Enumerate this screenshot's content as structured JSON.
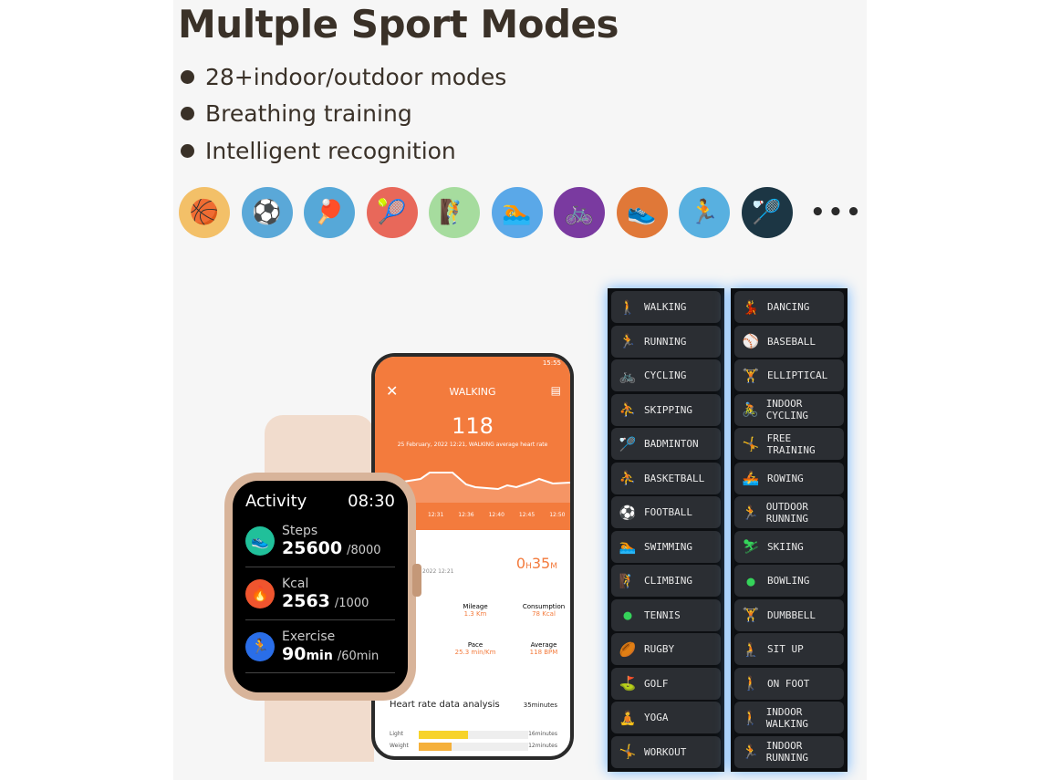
{
  "title": "Multple Sport Modes",
  "bullets": [
    "28+indoor/outdoor modes",
    "Breathing training",
    "Intelligent recognition"
  ],
  "sport_icons": [
    {
      "name": "basketball",
      "color": "#f3c068",
      "glyph": "🏀"
    },
    {
      "name": "soccer",
      "color": "#5aa8d8",
      "glyph": "⚽"
    },
    {
      "name": "ping-pong",
      "color": "#56a8d8",
      "glyph": "🏓"
    },
    {
      "name": "tennis",
      "color": "#e8685a",
      "glyph": "🎾"
    },
    {
      "name": "climbing",
      "color": "#a6dc9e",
      "glyph": "🧗"
    },
    {
      "name": "swimming",
      "color": "#5aa8e8",
      "glyph": "🏊"
    },
    {
      "name": "cycling",
      "color": "#7a3aa0",
      "glyph": "🚲"
    },
    {
      "name": "running-shoe",
      "color": "#e07838",
      "glyph": "👟"
    },
    {
      "name": "treadmill",
      "color": "#58b0e0",
      "glyph": "🏃"
    },
    {
      "name": "badminton",
      "color": "#1c3644",
      "glyph": "🏸"
    }
  ],
  "more": "•••",
  "list_left": [
    "WALKING",
    "RUNNING",
    "CYCLING",
    "SKIPPING",
    "BADMINTON",
    "BASKETBALL",
    "FOOTBALL",
    "SWIMMING",
    "CLIMBING",
    "TENNIS",
    "RUGBY",
    "GOLF",
    "YOGA",
    "WORKOUT"
  ],
  "list_right": [
    "DANCING",
    "BASEBALL",
    "ELLIPTICAL",
    "INDOOR CYCLING",
    "FREE TRAINING",
    "ROWING",
    "OUTDOOR RUNNING",
    "SKIING",
    "BOWLING",
    "DUMBBELL",
    "SIT UP",
    "ON FOOT",
    "INDOOR WALKING",
    "INDOOR RUNNING"
  ],
  "accent": "#35d35a",
  "phone": {
    "status_time": "15:55",
    "header": "WALKING",
    "heart_rate": "118",
    "subtitle": "25 February, 2022 12:21, WALKING average heart rate",
    "ticks": [
      "12:31",
      "12:36",
      "12:40",
      "12:45",
      "12:50",
      "12:5"
    ],
    "date": "2022 12:21",
    "duration_h": "0",
    "h": "H",
    "duration_m": "35",
    "m": "M",
    "stats": [
      {
        "label": "Mileage",
        "value": "1.3 Km"
      },
      {
        "label": "Consumption",
        "value": "78 Kcal"
      },
      {
        "label": "Pace",
        "value": "25.3 min/Km"
      },
      {
        "label": "Average",
        "value": "118 BPM"
      }
    ],
    "partial_left": [
      "ps",
      "ed",
      "TH"
    ],
    "analysis_title": "Heart rate data analysis",
    "analysis_total": "35minutes",
    "zones": [
      {
        "label": "Light",
        "value": "16minutes",
        "fraction": 0.45,
        "color": "#f7d32a"
      },
      {
        "label": "Weight",
        "value": "12minutes",
        "fraction": 0.3,
        "color": "#f5b03a"
      }
    ]
  },
  "watch": {
    "title": "Activity",
    "time": "08:30",
    "rows": [
      {
        "label": "Steps",
        "value": "25600",
        "unit": "",
        "goal": "/8000",
        "color": "#20c09a",
        "glyph": "👟"
      },
      {
        "label": "Kcal",
        "value": "2563",
        "unit": "",
        "goal": "/1000",
        "color": "#f0552e",
        "glyph": "🔥"
      },
      {
        "label": "Exercise",
        "value": "90",
        "unit": "min",
        "goal": "/60min",
        "color": "#2a6ee8",
        "glyph": "🏃"
      }
    ]
  }
}
